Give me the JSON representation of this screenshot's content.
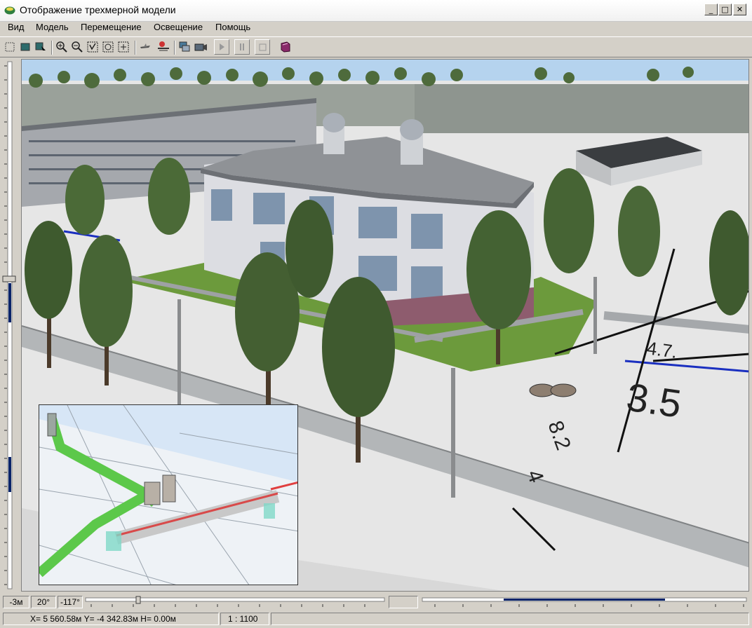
{
  "window": {
    "title": "Отображение трехмерной модели",
    "minimize": "_",
    "maximize": "□",
    "close": "✕"
  },
  "menu": {
    "items": [
      "Вид",
      "Модель",
      "Перемещение",
      "Освещение",
      "Помощь"
    ]
  },
  "toolbar": {
    "icons": [
      "select-rect-icon",
      "select-fill-icon",
      "select-cursor-icon",
      "zoom-in-icon",
      "zoom-out-icon",
      "zoom-window-icon",
      "zoom-extents-icon",
      "zoom-fit-icon",
      "fly-icon",
      "walk-icon",
      "copy-view-icon",
      "camera-icon",
      "play-icon",
      "pause-icon",
      "stop-icon",
      "help-book-icon"
    ]
  },
  "status": {
    "height": "-3м",
    "tilt": "20°",
    "heading": "-117°",
    "coords": "X= 5 560.58м  Y= -4 342.83м  H= 0.00м",
    "scale": "1 : 1100"
  },
  "scene": {
    "map_label_1": "3.5",
    "map_label_2": "4.7.",
    "map_label_3": "8.2",
    "map_label_4": "4"
  }
}
